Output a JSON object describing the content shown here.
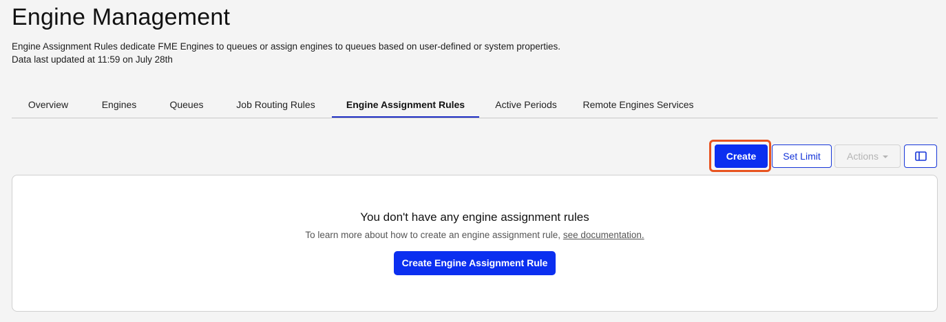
{
  "header": {
    "title": "Engine Management",
    "description": "Engine Assignment Rules dedicate FME Engines to queues or assign engines to queues based on user-defined or system properties.",
    "updated": "Data last updated at 11:59 on July 28th"
  },
  "tabs": [
    {
      "label": "Overview",
      "active": false
    },
    {
      "label": "Engines",
      "active": false
    },
    {
      "label": "Queues",
      "active": false
    },
    {
      "label": "Job Routing Rules",
      "active": false
    },
    {
      "label": "Engine Assignment Rules",
      "active": true
    },
    {
      "label": "Active Periods",
      "active": false
    },
    {
      "label": "Remote Engines Services",
      "active": false
    }
  ],
  "toolbar": {
    "create_label": "Create",
    "set_limit_label": "Set Limit",
    "actions_label": "Actions",
    "actions_disabled": true,
    "columns_icon": "columns-icon"
  },
  "empty_state": {
    "title": "You don't have any engine assignment rules",
    "text": "To learn more about how to create an engine assignment rule, ",
    "link_text": "see documentation.",
    "button_label": "Create Engine Assignment Rule"
  },
  "colors": {
    "primary": "#0b2ff0",
    "highlight": "#e8531f",
    "active_tab_underline": "#1d2ec4"
  }
}
